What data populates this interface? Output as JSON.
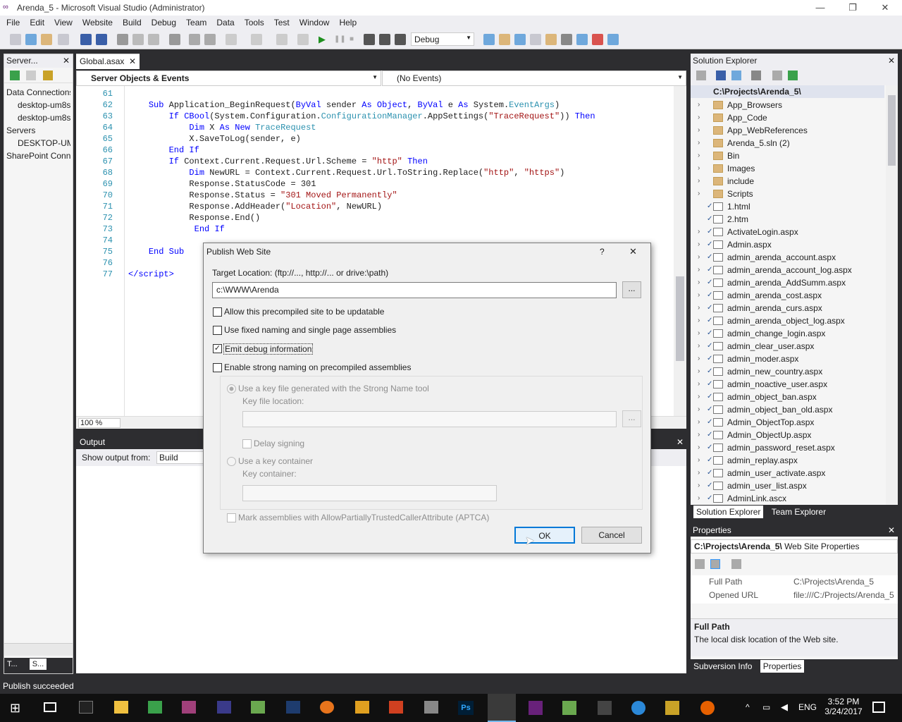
{
  "window": {
    "title": "Arenda_5 - Microsoft Visual Studio (Administrator)",
    "minimize": "—",
    "restore": "❐",
    "close": "✕"
  },
  "menu": [
    "File",
    "Edit",
    "View",
    "Website",
    "Build",
    "Debug",
    "Team",
    "Data",
    "Tools",
    "Test",
    "Window",
    "Help"
  ],
  "toolbar": {
    "configuration": "Debug"
  },
  "server_explorer": {
    "title": "Server...",
    "items": [
      "Data Connections",
      "desktop-um8s",
      "desktop-um8s",
      "Servers",
      "DESKTOP-UM",
      "SharePoint Conne"
    ],
    "bottom_tabs": [
      "T...",
      "S..."
    ]
  },
  "editor": {
    "tab_label": "Global.asax",
    "objects_dropdown": "Server Objects & Events",
    "events_dropdown": "(No Events)",
    "zoom": "100 %",
    "lines": [
      {
        "n": "61",
        "html": ""
      },
      {
        "n": "62",
        "html": "    <span class=\"kw\">Sub</span> Application_BeginRequest(<span class=\"kw\">ByVal</span> sender <span class=\"kw\">As</span> <span class=\"kw\">Object</span>, <span class=\"kw\">ByVal</span> e <span class=\"kw\">As</span> System.<span class=\"ty\">EventArgs</span>)"
      },
      {
        "n": "63",
        "html": "        <span class=\"kw\">If</span> <span class=\"kw\">CBool</span>(System.Configuration.<span class=\"ty\">ConfigurationManager</span>.AppSettings(<span class=\"st\">\"TraceRequest\"</span>)) <span class=\"kw\">Then</span>"
      },
      {
        "n": "64",
        "html": "            <span class=\"kw\">Dim</span> X <span class=\"kw\">As</span> <span class=\"kw\">New</span> <span class=\"ty\">TraceRequest</span>"
      },
      {
        "n": "65",
        "html": "            X.SaveToLog(sender, e)"
      },
      {
        "n": "66",
        "html": "        <span class=\"kw\">End</span> <span class=\"kw\">If</span>"
      },
      {
        "n": "67",
        "html": "        <span class=\"kw\">If</span> Context.Current.Request.Url.Scheme = <span class=\"st\">\"http\"</span> <span class=\"kw\">Then</span>"
      },
      {
        "n": "68",
        "html": "            <span class=\"kw\">Dim</span> NewURL = Context.Current.Request.Url.ToString.Replace(<span class=\"st\">\"http\"</span>, <span class=\"st\">\"https\"</span>)"
      },
      {
        "n": "69",
        "html": "            Response.StatusCode = 301"
      },
      {
        "n": "70",
        "html": "            Response.Status = <span class=\"st\">\"301 Moved Permanently\"</span>"
      },
      {
        "n": "71",
        "html": "            Response.AddHeader(<span class=\"st\">\"Location\"</span>, NewURL)"
      },
      {
        "n": "72",
        "html": "            Response.End()"
      },
      {
        "n": "73",
        "html": "             <span class=\"kw\">End</span> <span class=\"kw\">If</span>"
      },
      {
        "n": "74",
        "html": ""
      },
      {
        "n": "75",
        "html": "    <span class=\"kw\">End</span> <span class=\"kw\">Sub</span>"
      },
      {
        "n": "76",
        "html": ""
      },
      {
        "n": "77",
        "html": "<span class=\"kw\">&lt;/script&gt;</span>"
      }
    ]
  },
  "output": {
    "title": "Output",
    "show_label": "Show output from:",
    "source": "Build"
  },
  "solution_explorer": {
    "title": "Solution Explorer",
    "root": "C:\\Projects\\Arenda_5\\",
    "items": [
      {
        "label": "App_Browsers",
        "type": "folder",
        "chev": "›",
        "chk": ""
      },
      {
        "label": "App_Code",
        "type": "folder",
        "chev": "›",
        "chk": ""
      },
      {
        "label": "App_WebReferences",
        "type": "folder",
        "chev": "›",
        "chk": ""
      },
      {
        "label": "Arenda_5.sln (2)",
        "type": "folder",
        "chev": "›",
        "chk": ""
      },
      {
        "label": "Bin",
        "type": "folder",
        "chev": "›",
        "chk": ""
      },
      {
        "label": "Images",
        "type": "folder",
        "chev": "›",
        "chk": ""
      },
      {
        "label": "include",
        "type": "folder",
        "chev": "›",
        "chk": ""
      },
      {
        "label": "Scripts",
        "type": "folder",
        "chev": "›",
        "chk": ""
      },
      {
        "label": "1.html",
        "type": "page",
        "chev": "",
        "chk": "✓"
      },
      {
        "label": "2.htm",
        "type": "page",
        "chev": "",
        "chk": "✓"
      },
      {
        "label": "ActivateLogin.aspx",
        "type": "page",
        "chev": "›",
        "chk": "✓"
      },
      {
        "label": "Admin.aspx",
        "type": "page",
        "chev": "›",
        "chk": "✓"
      },
      {
        "label": "admin_arenda_account.aspx",
        "type": "page",
        "chev": "›",
        "chk": "✓"
      },
      {
        "label": "admin_arenda_account_log.aspx",
        "type": "page",
        "chev": "›",
        "chk": "✓"
      },
      {
        "label": "admin_arenda_AddSumm.aspx",
        "type": "page",
        "chev": "›",
        "chk": "✓"
      },
      {
        "label": "admin_arenda_cost.aspx",
        "type": "page",
        "chev": "›",
        "chk": "✓"
      },
      {
        "label": "admin_arenda_curs.aspx",
        "type": "page",
        "chev": "›",
        "chk": "✓"
      },
      {
        "label": "admin_arenda_object_log.aspx",
        "type": "page",
        "chev": "›",
        "chk": "✓"
      },
      {
        "label": "admin_change_login.aspx",
        "type": "page",
        "chev": "›",
        "chk": "✓"
      },
      {
        "label": "admin_clear_user.aspx",
        "type": "page",
        "chev": "›",
        "chk": "✓"
      },
      {
        "label": "admin_moder.aspx",
        "type": "page",
        "chev": "›",
        "chk": "✓"
      },
      {
        "label": "admin_new_country.aspx",
        "type": "page",
        "chev": "›",
        "chk": "✓"
      },
      {
        "label": "admin_noactive_user.aspx",
        "type": "page",
        "chev": "›",
        "chk": "✓"
      },
      {
        "label": "admin_object_ban.aspx",
        "type": "page",
        "chev": "›",
        "chk": "✓"
      },
      {
        "label": "admin_object_ban_old.aspx",
        "type": "page",
        "chev": "›",
        "chk": "✓"
      },
      {
        "label": "Admin_ObjectTop.aspx",
        "type": "page",
        "chev": "›",
        "chk": "✓"
      },
      {
        "label": "Admin_ObjectUp.aspx",
        "type": "page",
        "chev": "›",
        "chk": "✓"
      },
      {
        "label": "admin_password_reset.aspx",
        "type": "page",
        "chev": "›",
        "chk": "✓"
      },
      {
        "label": "admin_replay.aspx",
        "type": "page",
        "chev": "›",
        "chk": "✓"
      },
      {
        "label": "admin_user_activate.aspx",
        "type": "page",
        "chev": "›",
        "chk": "✓"
      },
      {
        "label": "admin_user_list.aspx",
        "type": "page",
        "chev": "›",
        "chk": "✓"
      },
      {
        "label": "AdminLink.ascx",
        "type": "page",
        "chev": "›",
        "chk": "✓"
      }
    ],
    "tab_solution": "Solution Explorer",
    "tab_team": "Team Explorer"
  },
  "properties": {
    "title": "Properties",
    "object": "C:\\Projects\\Arenda_5\\",
    "object_type": "Web Site Properties",
    "rows": [
      {
        "name": "Full Path",
        "value": "C:\\Projects\\Arenda_5"
      },
      {
        "name": "Opened URL",
        "value": "file:///C:/Projects/Arenda_5"
      }
    ],
    "desc_title": "Full Path",
    "desc_text": "The local disk location of the Web site.",
    "tab_svn": "Subversion Info",
    "tab_props": "Properties"
  },
  "status": {
    "text": "Publish succeeded"
  },
  "taskbar": {
    "time": "3:52 PM",
    "date": "3/24/2017",
    "lang": "ENG"
  },
  "dialog": {
    "title": "Publish Web Site",
    "help": "?",
    "close": "✕",
    "target_label": "Target Location: (ftp://..., http://... or drive:\\path)",
    "target_value": "c:\\WWW\\Arenda",
    "browse": "...",
    "opt_updatable": "Allow this precompiled site to be updatable",
    "opt_fixed": "Use fixed naming and single page assemblies",
    "opt_debug": "Emit debug information",
    "opt_strong": "Enable strong naming on precompiled assemblies",
    "radio_keyfile": "Use a key file generated with the Strong Name tool",
    "keyfile_label": "Key file location:",
    "delay_sign": "Delay signing",
    "radio_container": "Use a key container",
    "container_label": "Key container:",
    "aptca": "Mark assemblies with AllowPartiallyTrustedCallerAttribute (APTCA)",
    "ok": "OK",
    "cancel": "Cancel"
  }
}
